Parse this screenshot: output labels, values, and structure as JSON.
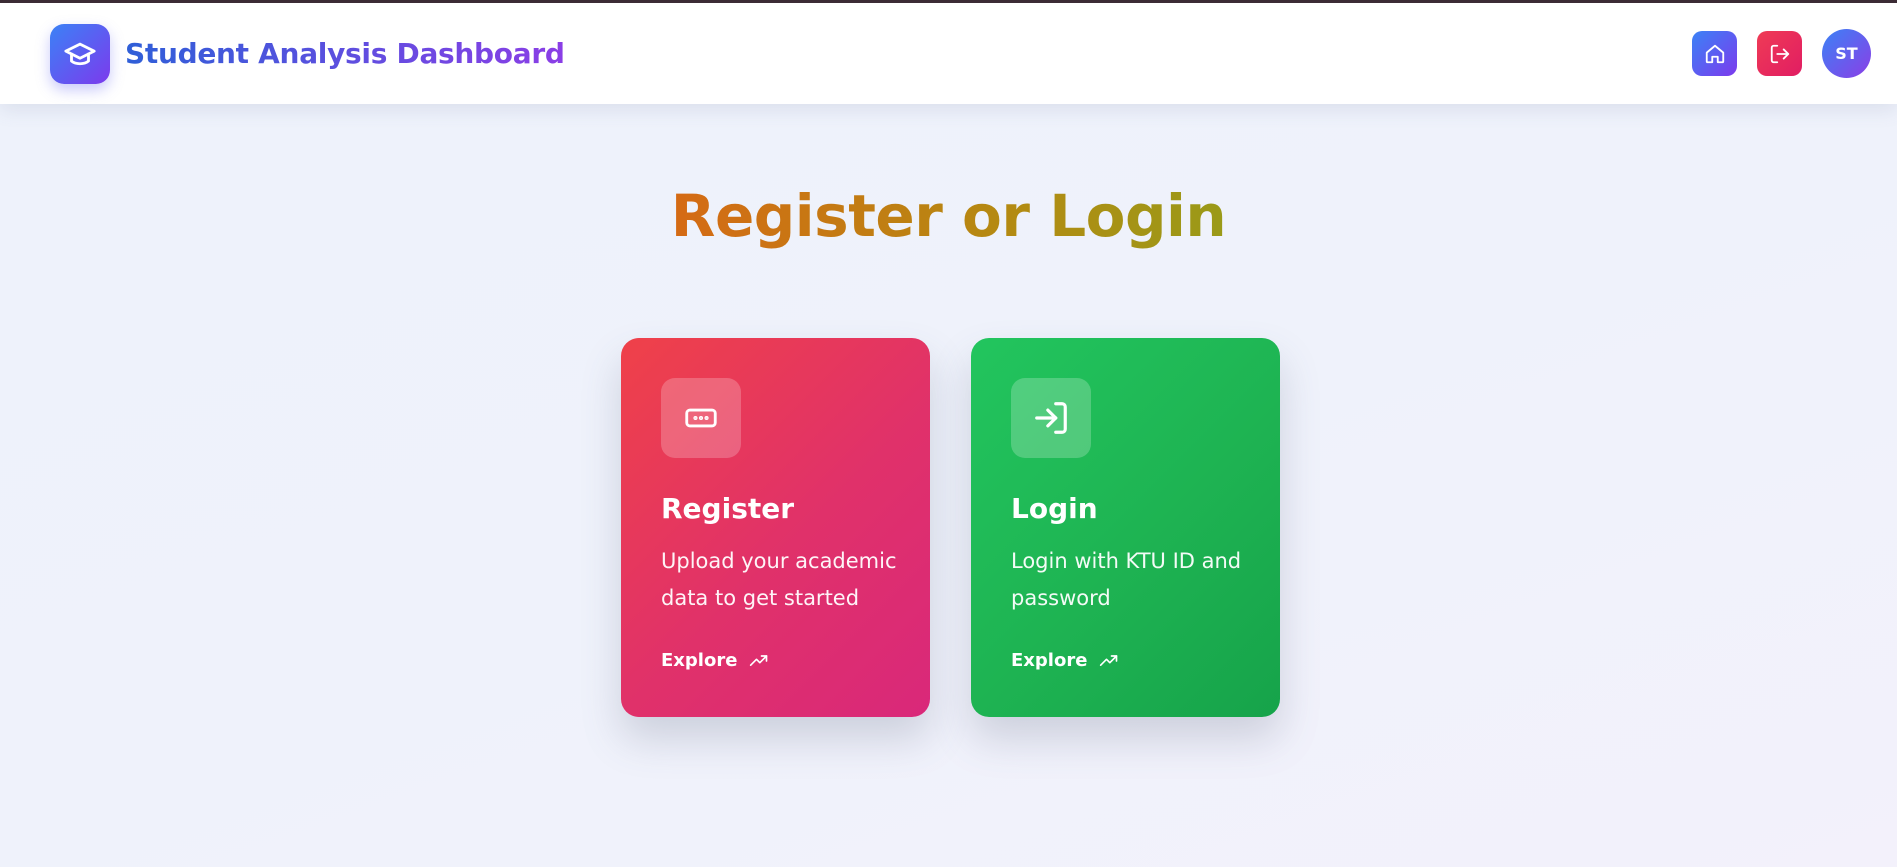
{
  "header": {
    "title": "Student Analysis Dashboard",
    "logo_icon": "graduation-cap-icon",
    "home_icon": "home-icon",
    "logout_icon": "logout-icon",
    "avatar_initials": "ST"
  },
  "main": {
    "title": "Register or Login",
    "cards": [
      {
        "title": "Register",
        "description": "Upload your academic data to get started",
        "action": "Explore",
        "icon": "form-input-icon",
        "action_icon": "trending-up-icon"
      },
      {
        "title": "Login",
        "description": "Login with KTU ID and password",
        "action": "Explore",
        "icon": "login-icon",
        "action_icon": "trending-up-icon"
      }
    ]
  },
  "colors": {
    "brand_start": "#3b82f6",
    "brand_end": "#7c3aed",
    "register_card": "#e0316a",
    "login_card": "#1eb352",
    "logout_button": "#e11d63",
    "title_gradient_start": "#d56a14",
    "title_gradient_end": "#9a9a18"
  }
}
